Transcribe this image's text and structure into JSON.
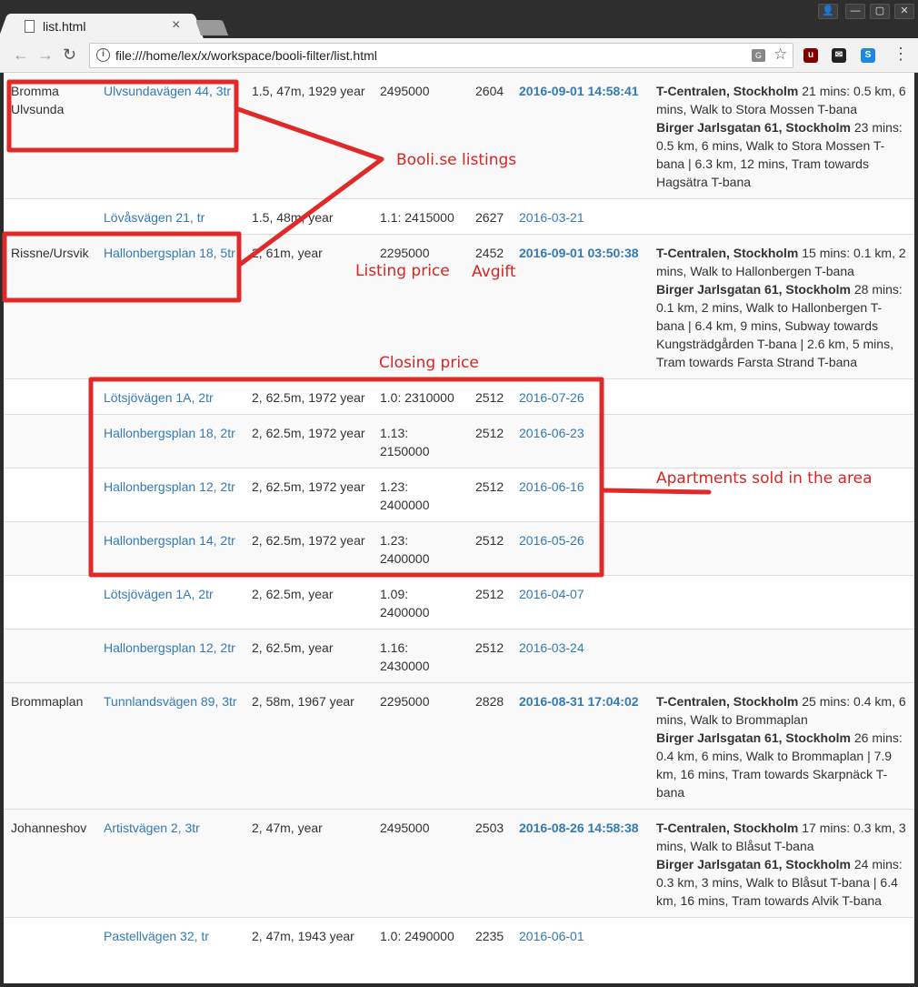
{
  "window": {
    "tab_title": "list.html",
    "tab_close": "×",
    "controls": [
      "👤",
      "—",
      "▢",
      "✕"
    ]
  },
  "toolbar": {
    "back": "←",
    "forward": "→",
    "reload": "↻",
    "info_icon": "i",
    "url": "file:///home/lex/x/workspace/booli-filter/list.html",
    "translate_icon": "G",
    "star_icon": "☆",
    "extensions": [
      {
        "name": "ublock",
        "glyph": "u",
        "color": "#800000"
      },
      {
        "name": "mail-off",
        "glyph": "✉",
        "color": "#222222"
      },
      {
        "name": "skype",
        "glyph": "S",
        "color": "#1e88e5"
      }
    ],
    "menu": "⋮"
  },
  "rows": [
    {
      "type": "listing",
      "area": "Bromma Ulvsunda",
      "address": "Ulvsundavägen 44, 3tr",
      "details": "1.5, 47m, 1929 year",
      "price": "2495000",
      "fee": "2604",
      "date": "2016-09-01 14:58:41",
      "commute": [
        {
          "place": "T-Centralen, Stockholm",
          "text": " 21 mins: 0.5 km, 6 mins, Walk to Stora Mossen T-bana"
        },
        {
          "place": "Birger Jarlsgatan 61, Stockholm",
          "text": " 23 mins: 0.5 km, 6 mins, Walk to Stora Mossen T-bana | 6.3 km, 12 mins, Tram towards Hagsätra T-bana"
        }
      ]
    },
    {
      "type": "sold",
      "area": "",
      "address": "Lövåsvägen 21, tr",
      "details": "1.5, 48m, year",
      "price": "1.1: 2415000",
      "fee": "2627",
      "date": "2016-03-21"
    },
    {
      "type": "listing",
      "area": "Rissne/Ursvik",
      "address": "Hallonbergsplan 18, 5tr",
      "details": "2, 61m, year",
      "price": "2295000",
      "fee": "2452",
      "date": "2016-09-01 03:50:38",
      "commute": [
        {
          "place": "T-Centralen, Stockholm",
          "text": " 15 mins: 0.1 km, 2 mins, Walk to Hallonbergen T-bana"
        },
        {
          "place": "Birger Jarlsgatan 61, Stockholm",
          "text": " 28 mins: 0.1 km, 2 mins, Walk to Hallonbergen T-bana | 6.4 km, 9 mins, Subway towards Kungsträdgården T-bana | 2.6 km, 5 mins, Tram towards Farsta Strand T-bana"
        }
      ]
    },
    {
      "type": "sold",
      "area": "",
      "address": "Lötsjövägen 1A, 2tr",
      "details": "2, 62.5m, 1972 year",
      "price": "1.0: 2310000",
      "fee": "2512",
      "date": "2016-07-26"
    },
    {
      "type": "sold",
      "area": "",
      "address": "Hallonbergsplan 18, 2tr",
      "details": "2, 62.5m, 1972 year",
      "price": "1.13: 2150000",
      "fee": "2512",
      "date": "2016-06-23"
    },
    {
      "type": "sold",
      "area": "",
      "address": "Hallonbergsplan 12, 2tr",
      "details": "2, 62.5m, 1972 year",
      "price": "1.23: 2400000",
      "fee": "2512",
      "date": "2016-06-16"
    },
    {
      "type": "sold",
      "area": "",
      "address": "Hallonbergsplan 14, 2tr",
      "details": "2, 62.5m, 1972 year",
      "price": "1.23: 2400000",
      "fee": "2512",
      "date": "2016-05-26"
    },
    {
      "type": "sold",
      "area": "",
      "address": "Lötsjövägen 1A, 2tr",
      "details": "2, 62.5m, year",
      "price": "1.09: 2400000",
      "fee": "2512",
      "date": "2016-04-07"
    },
    {
      "type": "sold",
      "area": "",
      "address": "Hallonbergsplan 12, 2tr",
      "details": "2, 62.5m, year",
      "price": "1.16: 2430000",
      "fee": "2512",
      "date": "2016-03-24"
    },
    {
      "type": "listing",
      "area": "Brommaplan",
      "address": "Tunnlandsvägen 89, 3tr",
      "details": "2, 58m, 1967 year",
      "price": "2295000",
      "fee": "2828",
      "date": "2016-08-31 17:04:02",
      "commute": [
        {
          "place": "T-Centralen, Stockholm",
          "text": " 25 mins: 0.4 km, 6 mins, Walk to Brommaplan"
        },
        {
          "place": "Birger Jarlsgatan 61, Stockholm",
          "text": " 26 mins: 0.4 km, 6 mins, Walk to Brommaplan | 7.9 km, 16 mins, Tram towards Skarpnäck T-bana"
        }
      ]
    },
    {
      "type": "listing",
      "area": "Johanneshov",
      "address": "Artistvägen 2, 3tr",
      "details": "2, 47m, year",
      "price": "2495000",
      "fee": "2503",
      "date": "2016-08-26 14:58:38",
      "commute": [
        {
          "place": "T-Centralen, Stockholm",
          "text": " 17 mins: 0.3 km, 3 mins, Walk to Blåsut T-bana"
        },
        {
          "place": "Birger Jarlsgatan 61, Stockholm",
          "text": " 24 mins: 0.3 km, 3 mins, Walk to Blåsut T-bana | 6.4 km, 16 mins, Tram towards Alvik T-bana"
        }
      ]
    },
    {
      "type": "sold",
      "area": "",
      "address": "Pastellvägen 32, tr",
      "details": "2, 47m, 1943 year",
      "price": "1.0: 2490000",
      "fee": "2235",
      "date": "2016-06-01"
    }
  ],
  "annotations": {
    "color": "#d92424",
    "labels": {
      "listings": "Booli.se listings",
      "listing_price": "Listing price",
      "fee": "Avgift",
      "closing_price": "Closing price",
      "sold": "Apartments sold in the area"
    }
  }
}
